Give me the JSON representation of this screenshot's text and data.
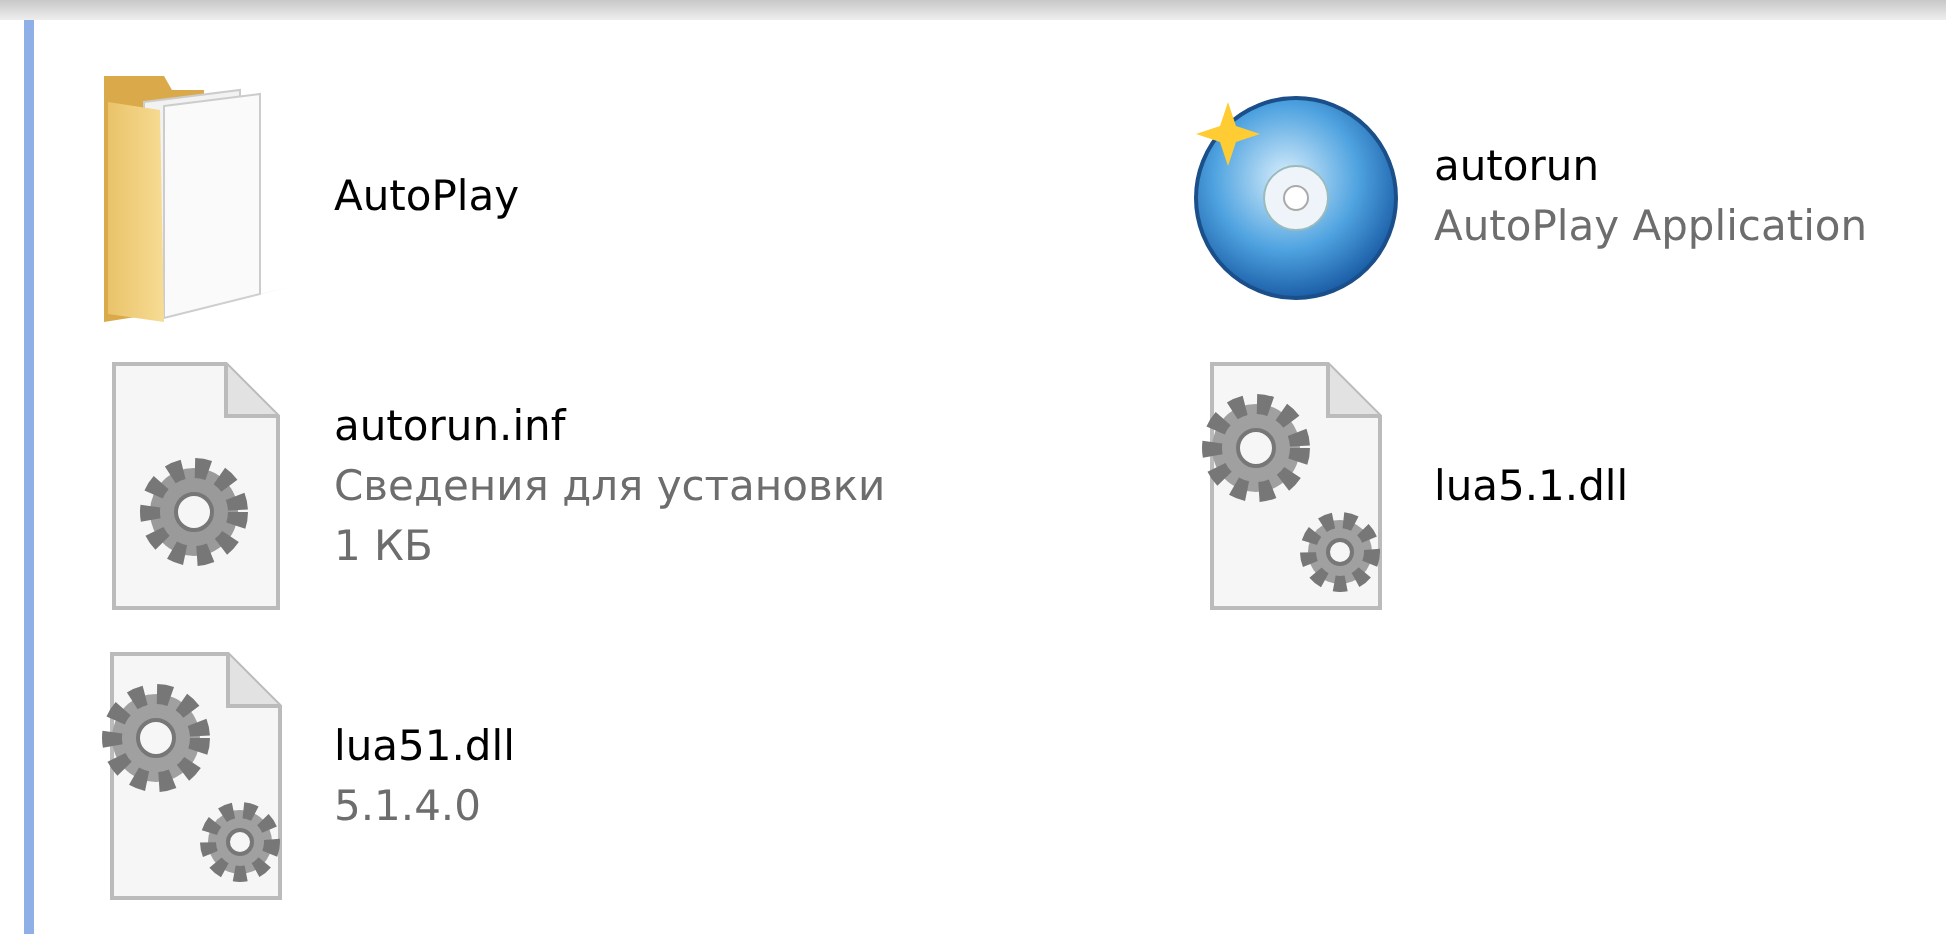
{
  "items": [
    {
      "kind": "folder",
      "name": "AutoPlay"
    },
    {
      "kind": "disc",
      "name": "autorun",
      "details": [
        "AutoPlay Application"
      ]
    },
    {
      "kind": "settings-file",
      "name": "autorun.inf",
      "details": [
        "Сведения для установки",
        "1 КБ"
      ]
    },
    {
      "kind": "dll",
      "name": "lua5.1.dll"
    },
    {
      "kind": "dll",
      "name": "lua51.dll",
      "details": [
        "5.1.4.0"
      ]
    }
  ]
}
